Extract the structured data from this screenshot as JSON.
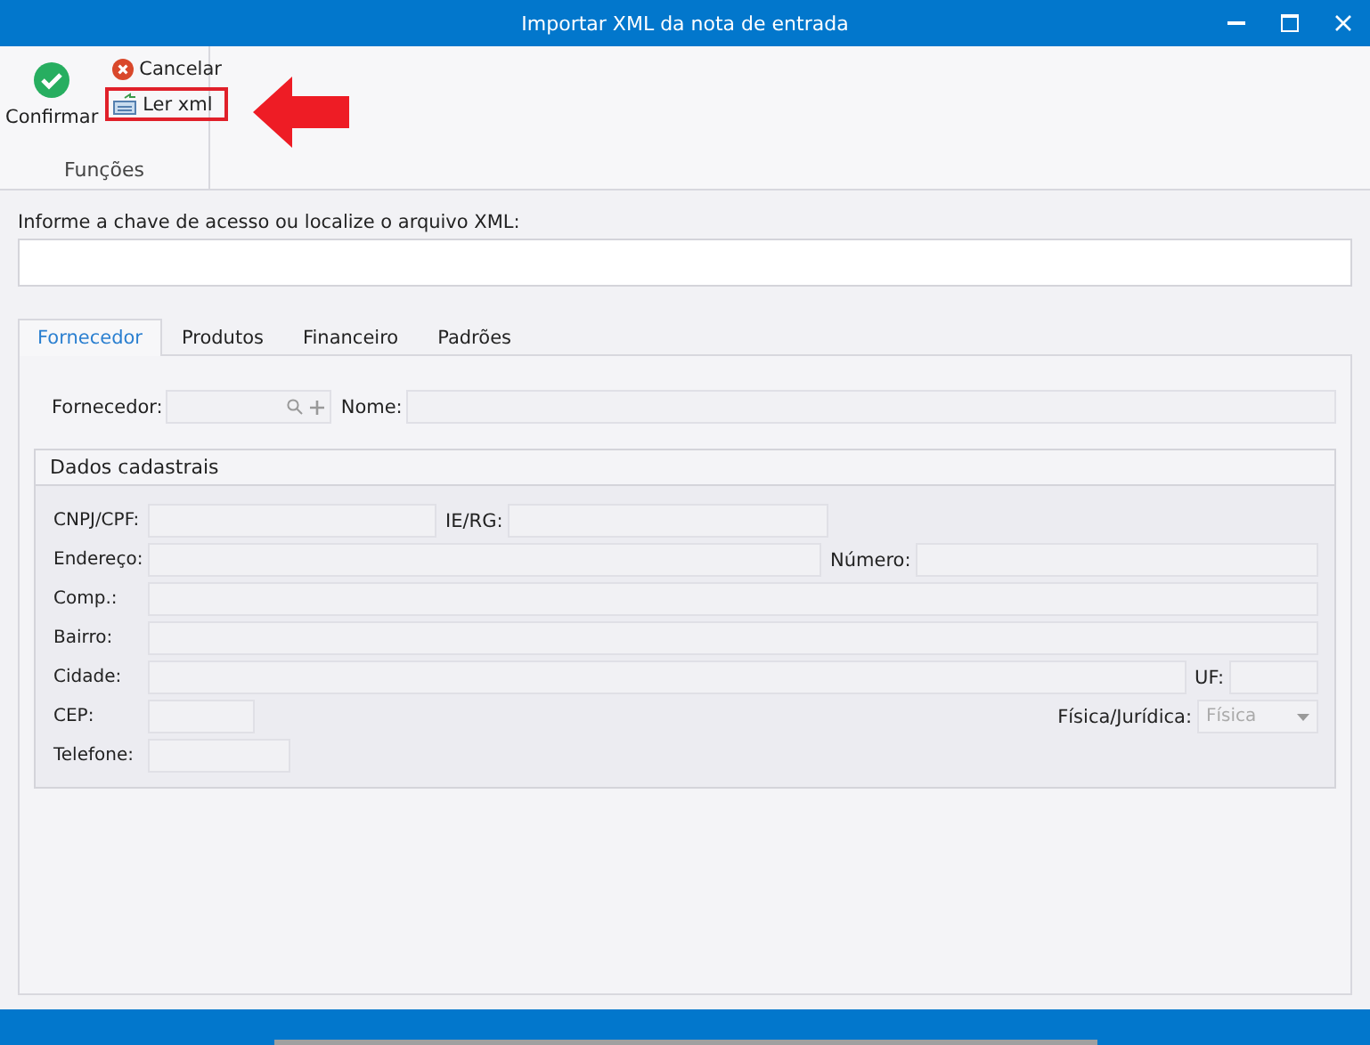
{
  "window": {
    "title": "Importar XML da nota de entrada"
  },
  "ribbon": {
    "group_label": "Funções",
    "buttons": [
      {
        "kind": "confirm",
        "label": "Confirmar",
        "highlighted": false
      },
      {
        "kind": "cancel",
        "label": "Cancelar",
        "highlighted": false
      },
      {
        "kind": "read",
        "label": "Ler xml",
        "highlighted": true
      }
    ]
  },
  "xml_input": {
    "label": "Informe a chave de acesso ou localize o arquivo XML:"
  },
  "tabs": [
    {
      "label": "Fornecedor",
      "selected": true
    },
    {
      "label": "Produtos",
      "selected": false
    },
    {
      "label": "Financeiro",
      "selected": false
    },
    {
      "label": "Padrões",
      "selected": false
    }
  ],
  "supplier": {
    "code_label": "Fornecedor:",
    "name_label": "Nome:"
  },
  "details": {
    "title": "Dados cadastrais",
    "rows": [
      [
        {
          "label": "CNPJ/CPF:"
        },
        {
          "label": "IE/RG:"
        }
      ],
      [
        {
          "label": "Endereço:"
        },
        {
          "label": "Número:"
        }
      ],
      [
        {
          "label": "Comp.:"
        }
      ],
      [
        {
          "label": "Bairro:"
        }
      ],
      [
        {
          "label": "Cidade:"
        },
        {
          "label": "UF:"
        }
      ],
      [
        {
          "label": "CEP:"
        },
        {
          "label": "Física/Jurídica:",
          "kind": "select",
          "value": "Física"
        }
      ],
      [
        {
          "label": "Telefone:"
        }
      ]
    ]
  }
}
